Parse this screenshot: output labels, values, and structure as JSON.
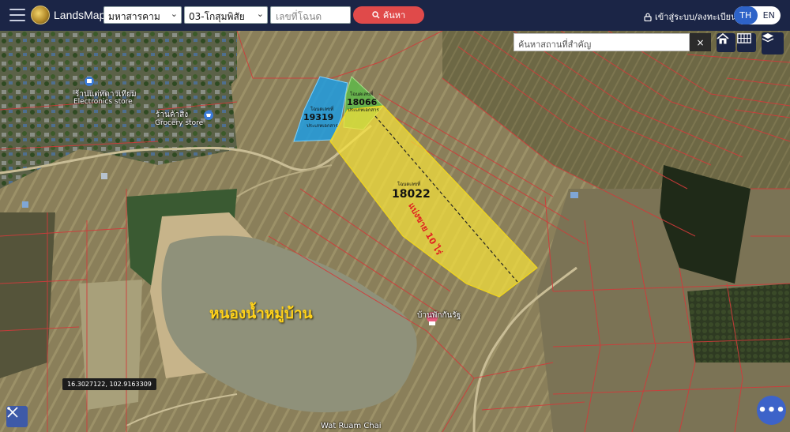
{
  "header": {
    "brand": "LandsMaps",
    "province_select": "มหาสารคาม",
    "district_select": "03-โกสุมพิสัย",
    "deed_placeholder": "เลขที่โฉนด",
    "search_label": "ค้นหา",
    "login_label": "เข้าสู่ระบบ/ลงทะเบียน",
    "lang_th": "TH",
    "lang_en": "EN"
  },
  "map": {
    "place_search_placeholder": "ค้นหาสถานที่สำคัญ",
    "clear_symbol": "×",
    "coordinates": "16.3027122, 102.9163309",
    "more_symbol": "•••",
    "pond_label": "หนองน้ำหมู่บ้าน",
    "divide_label": "แบ่งขาย 10 ไร่",
    "plots": [
      {
        "caption": "โฉนดเลขที่",
        "number": "19319",
        "sub": "ประเภทเอกสาร"
      },
      {
        "caption": "โฉนดเลขที่",
        "number": "18066",
        "sub": "ประเภทเอกสาร"
      },
      {
        "caption": "โฉนดเลขที่",
        "number": "18022",
        "sub": ""
      }
    ],
    "pois": {
      "electronics_th": "ร้านแต่ทดาวเทียม",
      "electronics_en": "Electronics store",
      "grocery_th": "ร้านค้าสิ่ง",
      "grocery_en": "Grocery store",
      "shop": "บ้านพักกันรัฐ",
      "temple": "Wat Ruam Chai"
    },
    "colors": {
      "plot_blue": "#1f9be0",
      "plot_green": "#5fb84a",
      "plot_yellow": "#f6e23a",
      "label_yellow": "#ffd21a",
      "parcel_line": "#d23a3a"
    }
  }
}
